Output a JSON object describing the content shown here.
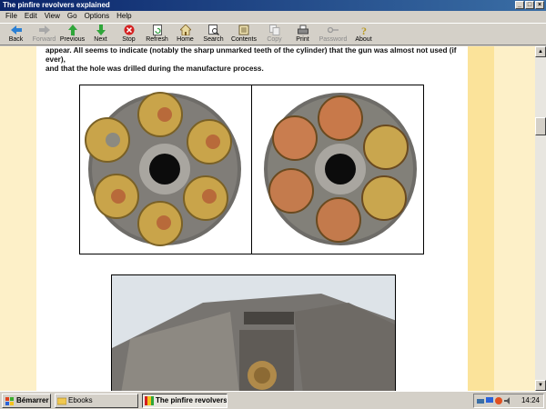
{
  "window": {
    "title": "The pinfire revolvers explained"
  },
  "window_buttons": {
    "minimize": "_",
    "maximize": "□",
    "close": "×"
  },
  "menu": [
    "File",
    "Edit",
    "View",
    "Go",
    "Options",
    "Help"
  ],
  "toolbar": [
    {
      "label": "Back",
      "icon": "back-arrow-icon",
      "enabled": true
    },
    {
      "label": "Forward",
      "icon": "forward-arrow-icon",
      "enabled": false
    },
    {
      "label": "Previous",
      "icon": "up-arrow-icon",
      "enabled": true
    },
    {
      "label": "Next",
      "icon": "down-arrow-icon",
      "enabled": true
    },
    {
      "label": "Stop",
      "icon": "stop-icon",
      "enabled": true
    },
    {
      "label": "Refresh",
      "icon": "refresh-icon",
      "enabled": true
    },
    {
      "label": "Home",
      "icon": "home-icon",
      "enabled": true
    },
    {
      "label": "Search",
      "icon": "search-icon",
      "enabled": true
    },
    {
      "label": "Contents",
      "icon": "contents-icon",
      "enabled": true
    },
    {
      "label": "Copy",
      "icon": "copy-icon",
      "enabled": false
    },
    {
      "label": "Print",
      "icon": "print-icon",
      "enabled": true
    },
    {
      "label": "Password",
      "icon": "key-icon",
      "enabled": false
    },
    {
      "label": "About",
      "icon": "about-icon",
      "enabled": true
    }
  ],
  "content": {
    "paragraph_line1": "appear. All seems to indicate (notably the sharp unmarked teeth of the cylinder) that the gun was almost not used (if ever),",
    "paragraph_line2": "and that the hole was drilled during the manufacture process."
  },
  "scrollbar": {
    "up": "▲",
    "down": "▼"
  },
  "taskbar": {
    "start_label": "Bémarrer",
    "tasks": [
      {
        "label": "Ebooks",
        "active": false
      },
      {
        "label": "The pinfire revolvers ...",
        "active": true
      }
    ],
    "clock": "14:24"
  },
  "colors": {
    "titlebar_start": "#0a246a",
    "titlebar_end": "#3a6ea5",
    "page_background": "#ffffff",
    "margin_cream": "#fdf0c8",
    "margin_yellow": "#fbe39a"
  }
}
